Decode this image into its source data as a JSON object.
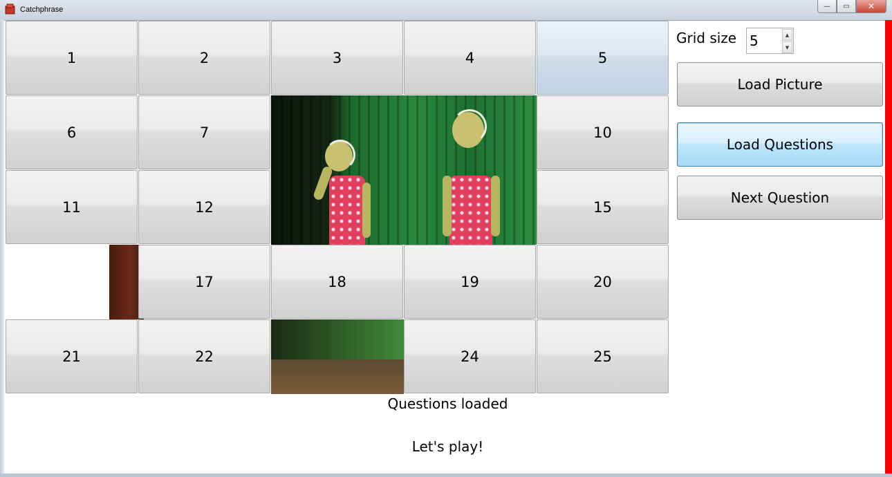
{
  "window": {
    "title": "Catchphrase",
    "minimize_label": "—",
    "maximize_label": "▭",
    "close_label": "✕"
  },
  "grid": {
    "tiles": [
      {
        "label": "1"
      },
      {
        "label": "2"
      },
      {
        "label": "3"
      },
      {
        "label": "4"
      },
      {
        "label": "5"
      },
      {
        "label": "6"
      },
      {
        "label": "7"
      },
      {
        "label": "10"
      },
      {
        "label": "11"
      },
      {
        "label": "12"
      },
      {
        "label": "15"
      },
      {
        "label": "17"
      },
      {
        "label": "18"
      },
      {
        "label": "19"
      },
      {
        "label": "20"
      },
      {
        "label": "21"
      },
      {
        "label": "22"
      },
      {
        "label": "24"
      },
      {
        "label": "25"
      }
    ]
  },
  "controls": {
    "grid_size_label": "Grid size",
    "grid_size_value": "5",
    "load_picture": "Load Picture",
    "load_questions": "Load Questions",
    "next_question": "Next Question"
  },
  "status": {
    "line1": "Questions loaded",
    "line2": "Let's play!"
  },
  "colors": {
    "accent_border": "#ff0000",
    "focus_border": "#3c7fb1"
  }
}
